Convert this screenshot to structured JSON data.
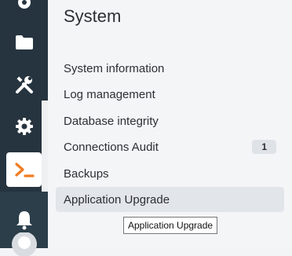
{
  "panel": {
    "title": "System",
    "items": [
      {
        "label": "System information"
      },
      {
        "label": "Log management"
      },
      {
        "label": "Database integrity"
      },
      {
        "label": "Connections Audit",
        "badge": "1"
      },
      {
        "label": "Backups"
      },
      {
        "label": "Application Upgrade"
      }
    ]
  },
  "tooltip": {
    "text": "Application Upgrade"
  },
  "sidebar": {
    "icons": [
      "wrench-gear-icon",
      "folder-icon",
      "tools-icon",
      "gear-icon",
      "terminal-icon",
      "bell-icon",
      "avatar-icon"
    ],
    "active": "terminal-icon"
  },
  "colors": {
    "sidebar_bg": "#26343f",
    "panel_bg": "#f4f5f7",
    "accent": "#f07c22"
  }
}
